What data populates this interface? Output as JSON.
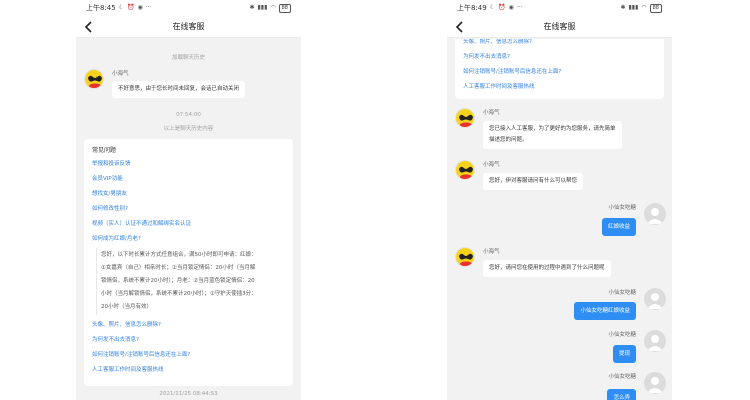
{
  "screen1": {
    "status": {
      "time": "上午8:45",
      "battery": "88"
    },
    "title": "在线客服",
    "load_history": "加载聊天历史",
    "bot_name": "小海气",
    "bot_message": "不好意思，由于您长时间未回复，会话已自动关闭",
    "time_divider": "07:54:00",
    "history_divider": "以上是聊天历史内容",
    "faq": {
      "title": "常见问题",
      "items": [
        "举报和投诉反馈",
        "会员VIP功能",
        "想找女/男朋友",
        "如何修改性别?",
        "视频（实人）认证不通过和解绑实名认证",
        "如何成为红娘/月老?"
      ],
      "answer_lines": [
        "您好，以下时长累计方式任意组合，满50小时即可申请：红娘：",
        "①女嘉宾（自己）相亲时长；②当月锁定情侣：20小时（当月解",
        "锁情侣，系统不累计20小时）；月老：②当月蓝色锁定情侣：20",
        "小时（当月解锁情侣，系统不累计20小时）；②守护天使插3分：",
        "20小时（当月有效）"
      ],
      "items_after": [
        "头像、照片、信息怎么删除?",
        "为何发不出去消息?",
        "如何注销账号/注销账号后信息还在上面?",
        "人工客服工作时间及客服热线"
      ]
    },
    "bottom_time": "2021/11/25 08:44:53"
  },
  "screen2": {
    "status": {
      "time": "上午8:49",
      "battery": "88"
    },
    "title": "在线客服",
    "faq_items": [
      "头像、照片、信息怎么删除?",
      "为何发不出去消息?",
      "如何注销账号/注销账号后信息还在上面?",
      "人工客服工作时间及客服热线"
    ],
    "messages": [
      {
        "from": "bot",
        "name": "小海气",
        "lines": [
          "您已接入人工客服，为了更好的为您服务，请先简单",
          "描述您的问题。"
        ]
      },
      {
        "from": "bot",
        "name": "小海气",
        "lines": [
          "您好，伊对客服请问有什么可以帮您"
        ]
      },
      {
        "from": "user",
        "name": "小仙女吃糖",
        "text": "红娘收益"
      },
      {
        "from": "bot",
        "name": "小海气",
        "lines": [
          "您好，请问您在使用的过程中遇到了什么问题呢"
        ]
      },
      {
        "from": "user",
        "name": "小仙女吃糖",
        "text": "小仙女吃糖红娘收益"
      },
      {
        "from": "user",
        "name": "小仙女吃糖",
        "text": "提现"
      },
      {
        "from": "user",
        "name": "小仙女吃糖",
        "text": "怎么弄"
      }
    ]
  },
  "colors": {
    "accent": "#2f8ef3",
    "link": "#2f7fe0",
    "chat_bg": "#f2f2f2",
    "avatar_yellow": "#f7d21d",
    "avatar_red": "#e8302c"
  },
  "icons": {
    "back": "chevron-left-icon",
    "bot_avatar": "yellow-heart-glasses-icon",
    "user_avatar": "default-person-icon"
  }
}
